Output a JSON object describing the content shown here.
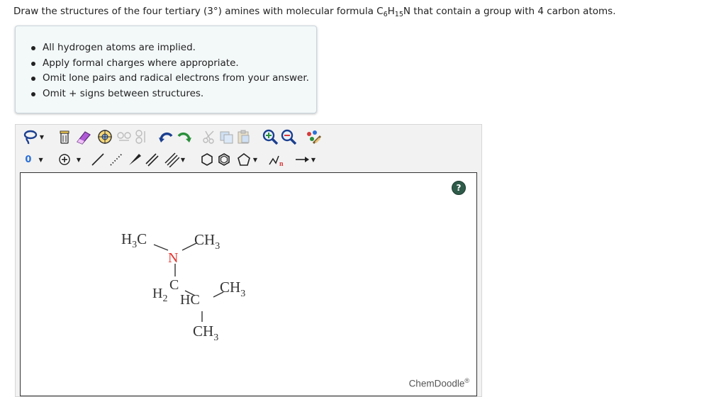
{
  "question": {
    "prefix": "Draw the structures of the four tertiary (3°) amines with molecular formula C",
    "sub1": "6",
    "mid1": "H",
    "sub2": "15",
    "suffix": "N that contain a group with 4 carbon atoms."
  },
  "instructions": [
    "All hydrogen atoms are implied.",
    "Apply formal charges where appropriate.",
    "Omit lone pairs and radical electrons from your answer.",
    "Omit + signs between structures."
  ],
  "toolbar": {
    "charge_value": "0",
    "accent_color": "#2a6fd6"
  },
  "canvas": {
    "help_label": "?",
    "watermark": "ChemDoodle",
    "watermark_mark": "®"
  },
  "molecule": {
    "atoms": {
      "h3c_left_main": "H",
      "h3c_left_sub": "3",
      "h3c_left_c": "C",
      "ch3_top_c": "CH",
      "ch3_top_sub": "3",
      "n": "N",
      "c_label": "C",
      "h2_label": "H",
      "h2_sub": "2",
      "hc_label": "HC",
      "ch3_right_c": "CH",
      "ch3_right_sub": "3",
      "ch3_bottom_c": "CH",
      "ch3_bottom_sub": "3"
    },
    "colors": {
      "nitrogen": "#e3342f",
      "carbon": "#333333"
    }
  }
}
